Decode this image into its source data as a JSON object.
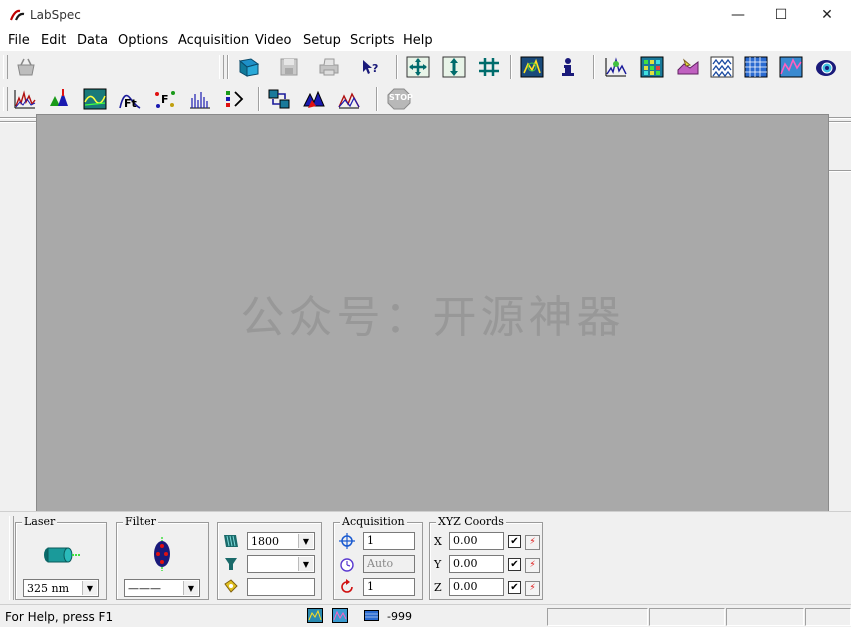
{
  "app": {
    "title": "LabSpec"
  },
  "window_controls": {
    "minimize": "—",
    "maximize": "☐",
    "close": "✕"
  },
  "menu": [
    "File",
    "Edit",
    "Data",
    "Options",
    "Acquisition",
    "Video",
    "Setup",
    "Scripts",
    "Help"
  ],
  "toolbar1": {
    "icons": [
      "basket-icon",
      "open-icon",
      "save-icon",
      "print-icon",
      "context-help-icon",
      "move-xy-icon",
      "move-z-icon",
      "move-stage-icon",
      "video-image-icon",
      "info-icon",
      "spectrum-map-icon",
      "grid-map-icon",
      "hand-map-icon",
      "multi-spectra-icon",
      "grid-icon",
      "map-chart-icon",
      "camera-icon"
    ]
  },
  "toolbar2": {
    "icons": [
      "spectrum-icon",
      "peak-mark-icon",
      "baseline-icon",
      "fit-icon",
      "function-icon",
      "multi-peak-icon",
      "math-icon",
      "data-transfer-icon",
      "spectra-3d-icon",
      "overlay-spectra-icon",
      "stop-icon"
    ],
    "stop_label": "STOP"
  },
  "watermark": "公众号：开源神器",
  "laser": {
    "title": "Laser",
    "value": "325 nm"
  },
  "filter": {
    "title": "Filter",
    "value": "———"
  },
  "grating": {
    "grating_value": "1800",
    "hole_value": "",
    "slit_value": ""
  },
  "acquisition": {
    "title": "Acquisition",
    "time": "1",
    "mode": "Auto",
    "accumulation": "1"
  },
  "xyz": {
    "title": "XYZ Coords",
    "rows": [
      {
        "axis": "X",
        "value": "0.00",
        "checked": "✔",
        "action": "⚡"
      },
      {
        "axis": "Y",
        "value": "0.00",
        "checked": "✔",
        "action": "⚡"
      },
      {
        "axis": "Z",
        "value": "0.00",
        "checked": "✔",
        "action": "⚡"
      }
    ]
  },
  "status": {
    "help_text": "For Help, press F1",
    "value": "-999"
  }
}
